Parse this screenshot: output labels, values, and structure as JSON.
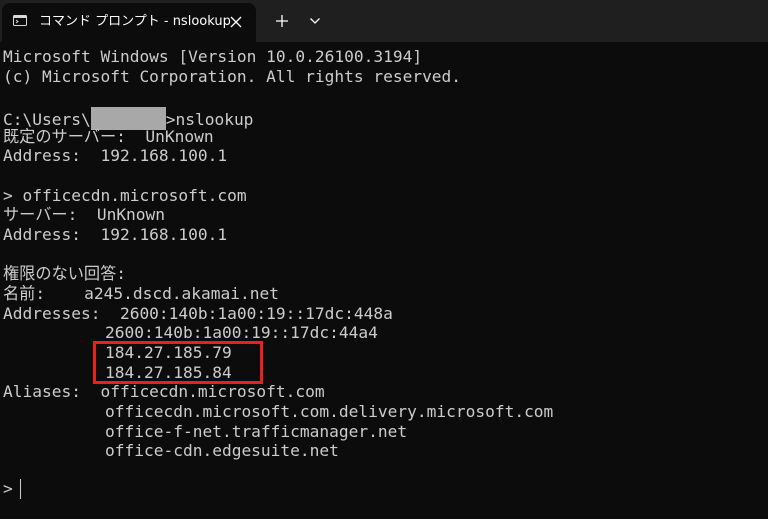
{
  "window": {
    "tab_title": "コマンド プロンプト - nslookup",
    "icons": {
      "tab": "command-prompt-icon",
      "close": "close-icon",
      "new_tab": "plus-icon",
      "dropdown": "chevron-down-icon"
    }
  },
  "colors": {
    "titlebar_bg": "#1f1f1f",
    "terminal_bg": "#0c0c0c",
    "text": "#cccccc",
    "highlight_border": "#e8211e",
    "redaction": "#a8a8a8"
  },
  "terminal": {
    "banner": [
      "Microsoft Windows [Version 10.0.26100.3194]",
      "(c) Microsoft Corporation. All rights reserved."
    ],
    "command": {
      "path_prefix": "C:\\Users\\",
      "path_suffix": ">nslookup"
    },
    "default_server": {
      "server_line": "既定のサーバー:  UnKnown",
      "address_line": "Address:  192.168.100.1"
    },
    "query": {
      "input_line": "> officecdn.microsoft.com",
      "server_line": "サーバー:  UnKnown",
      "address_line": "Address:  192.168.100.1"
    },
    "answer": {
      "header": "権限のない回答:",
      "name_line": "名前:    a245.dscd.akamai.net",
      "addresses_line": "Addresses:  2600:140b:1a00:19::17dc:448a",
      "extra_addresses": [
        "2600:140b:1a00:19::17dc:44a4",
        "184.27.185.79",
        "184.27.185.84"
      ],
      "aliases_line": "Aliases:  officecdn.microsoft.com",
      "extra_aliases": [
        "officecdn.microsoft.com.delivery.microsoft.com",
        "office-f-net.trafficmanager.net",
        "office-cdn.edgesuite.net"
      ]
    },
    "prompt": ">"
  }
}
